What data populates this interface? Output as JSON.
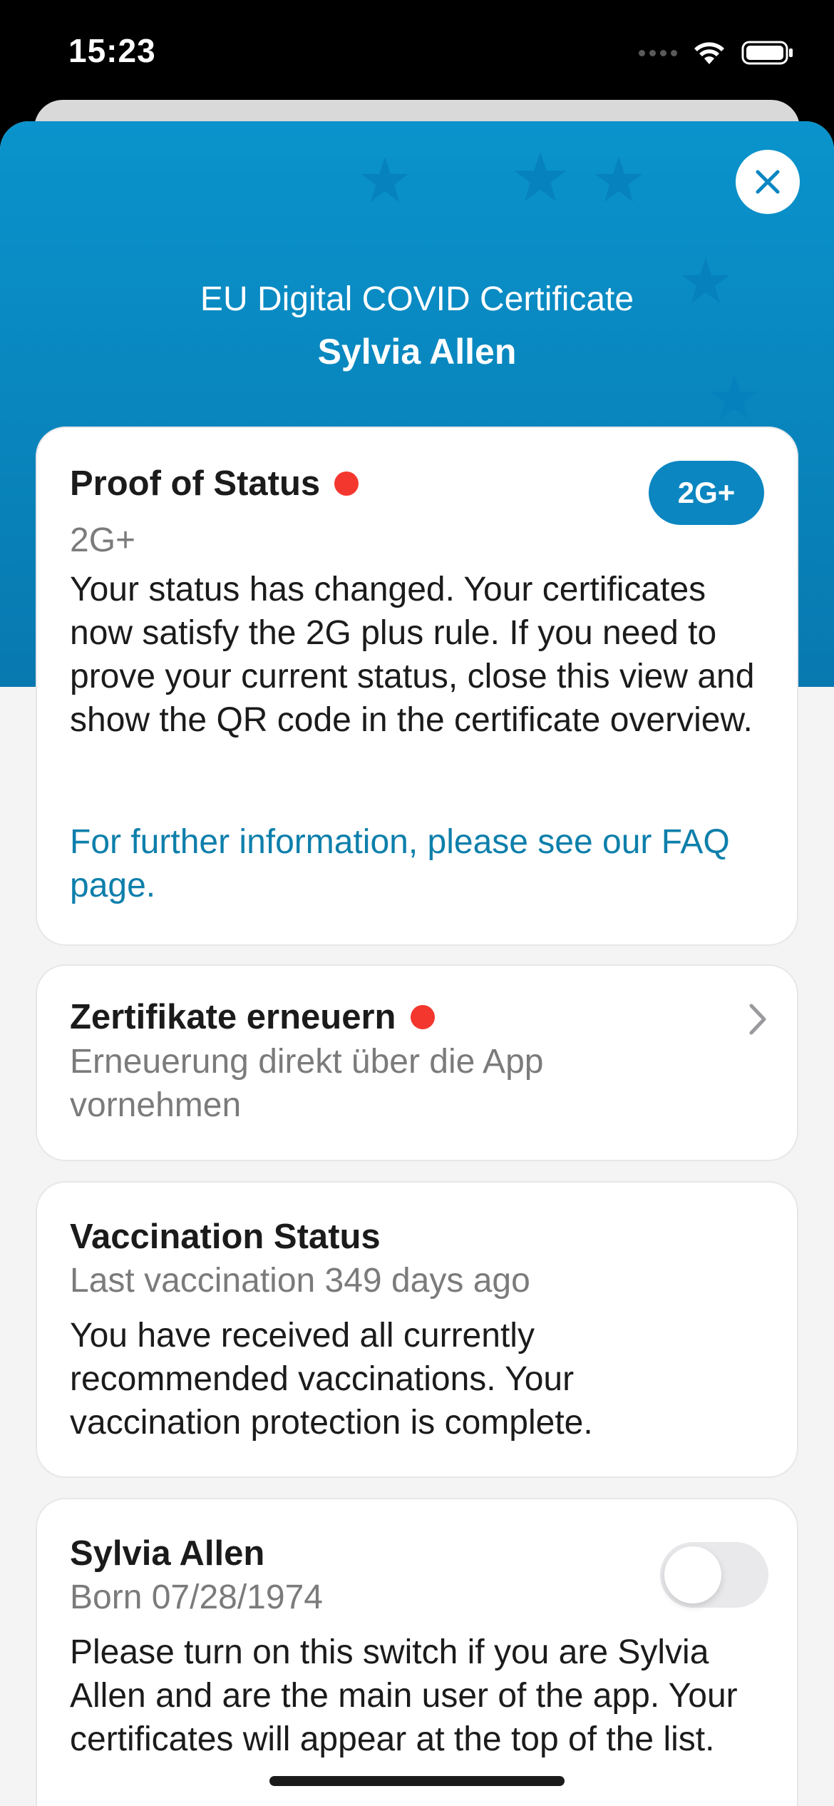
{
  "status_bar": {
    "time": "15:23"
  },
  "header": {
    "title": "EU Digital COVID Certificate",
    "name": "Sylvia Allen"
  },
  "proof_card": {
    "title": "Proof of Status",
    "subtitle": "2G+",
    "badge": "2G+",
    "body": "Your status has changed. Your certificates now satisfy the 2G plus rule. If you need to prove your current status, close this view and show the QR code in the certificate overview.",
    "link": "For further information, please see our FAQ page."
  },
  "renew_card": {
    "title": "Zertifikate erneuern",
    "subtitle": "Erneuerung direkt über die App vornehmen"
  },
  "vaccination_card": {
    "title": "Vaccination Status",
    "subtitle": "Last vaccination 349 days ago",
    "body": "You have received all currently recommended vaccinations. Your vaccination protection is complete."
  },
  "person_card": {
    "name": "Sylvia Allen",
    "born": "Born 07/28/1974",
    "body": "Please turn on this switch if you are Sylvia Allen and are the main user of the app. Your certificates will appear at the top of the list.",
    "toggle_on": false
  },
  "colors": {
    "hero_top": "#0a93cc",
    "hero_bottom": "#0879b0",
    "badge": "#0b86c1",
    "link": "#0d7fab",
    "alert_dot": "#f4372e"
  },
  "icons": [
    "wifi-icon",
    "battery-icon",
    "close-icon",
    "chevron-right-icon",
    "eu-star-icon"
  ]
}
